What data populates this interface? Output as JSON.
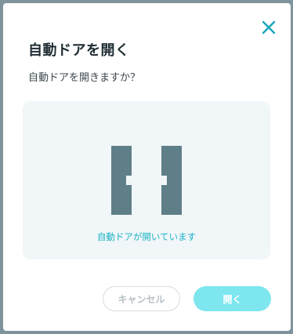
{
  "dialog": {
    "title": "自動ドアを開く",
    "message": "自動ドアを開きますか？",
    "close_icon": "close-icon"
  },
  "status": {
    "icon": "open-door-icon",
    "text": "自動ドアが開いています"
  },
  "buttons": {
    "cancel_label": "キャンセル",
    "open_label": "開く"
  },
  "colors": {
    "accent": "#17b3c6",
    "primary_disabled": "#7ee6ee",
    "door": "#5f7f88",
    "overlay": "#7f939c"
  }
}
